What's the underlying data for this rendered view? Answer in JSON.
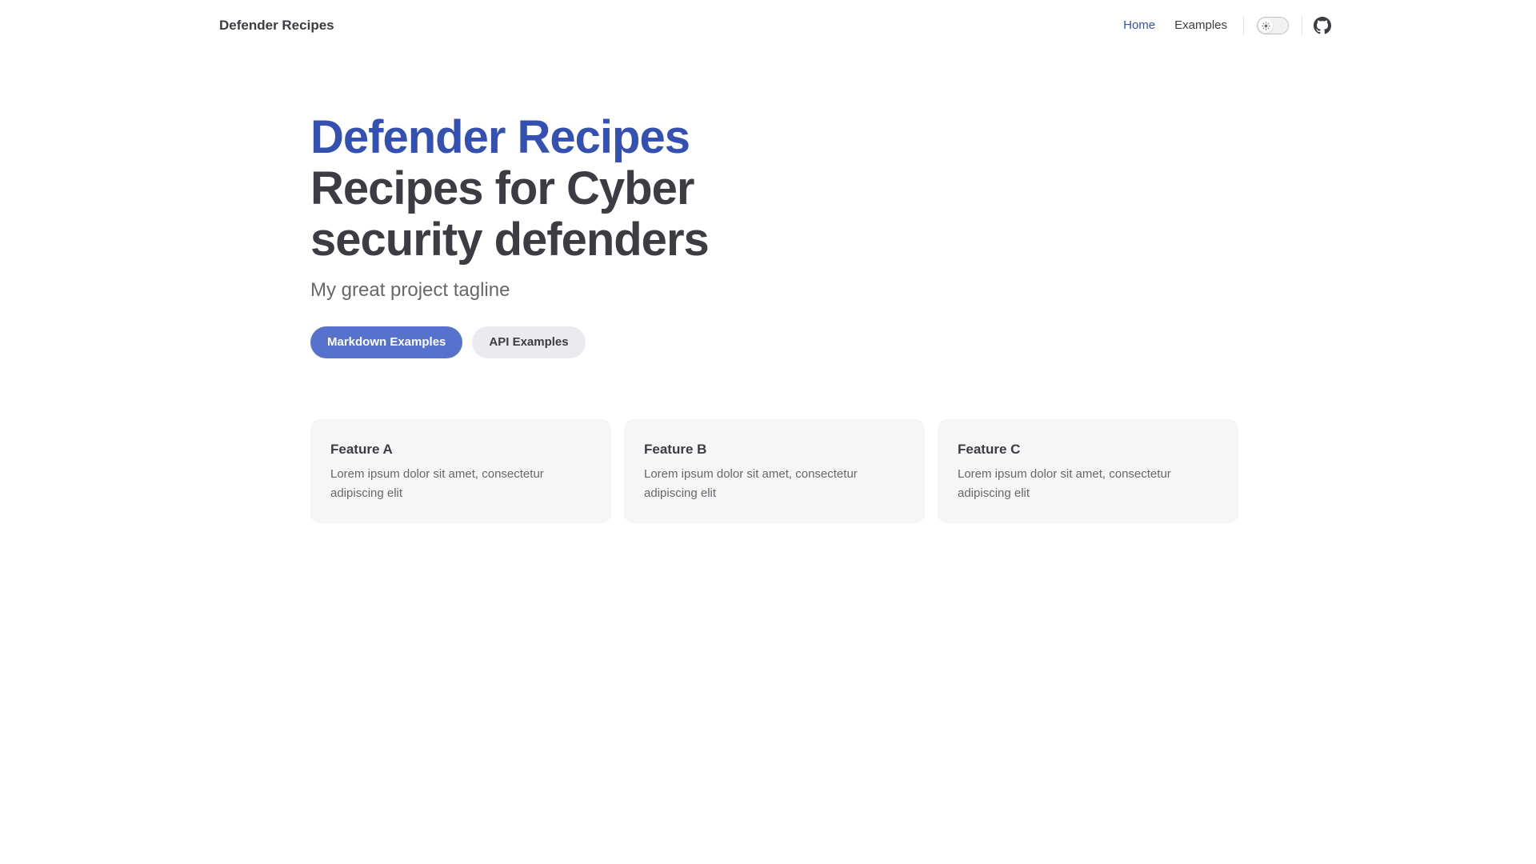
{
  "nav": {
    "title": "Defender Recipes",
    "links": [
      {
        "label": "Home",
        "active": true
      },
      {
        "label": "Examples",
        "active": false
      }
    ],
    "theme_toggle_icon": "sun-icon",
    "social_icon": "github-icon"
  },
  "hero": {
    "name": "Defender Recipes",
    "text": "Recipes for Cyber security defenders",
    "tagline": "My great project tagline",
    "actions": [
      {
        "label": "Markdown Examples",
        "theme": "brand"
      },
      {
        "label": "API Examples",
        "theme": "alt"
      }
    ]
  },
  "features": [
    {
      "title": "Feature A",
      "details": "Lorem ipsum dolor sit amet, consectetur adipiscing elit"
    },
    {
      "title": "Feature B",
      "details": "Lorem ipsum dolor sit amet, consectetur adipiscing elit"
    },
    {
      "title": "Feature C",
      "details": "Lorem ipsum dolor sit amet, consectetur adipiscing elit"
    }
  ],
  "colors": {
    "brand": "#3451b2",
    "brand_button": "#5672cd",
    "text": "#3c3c43",
    "muted": "#67676c",
    "card_bg": "#f6f6f7"
  }
}
